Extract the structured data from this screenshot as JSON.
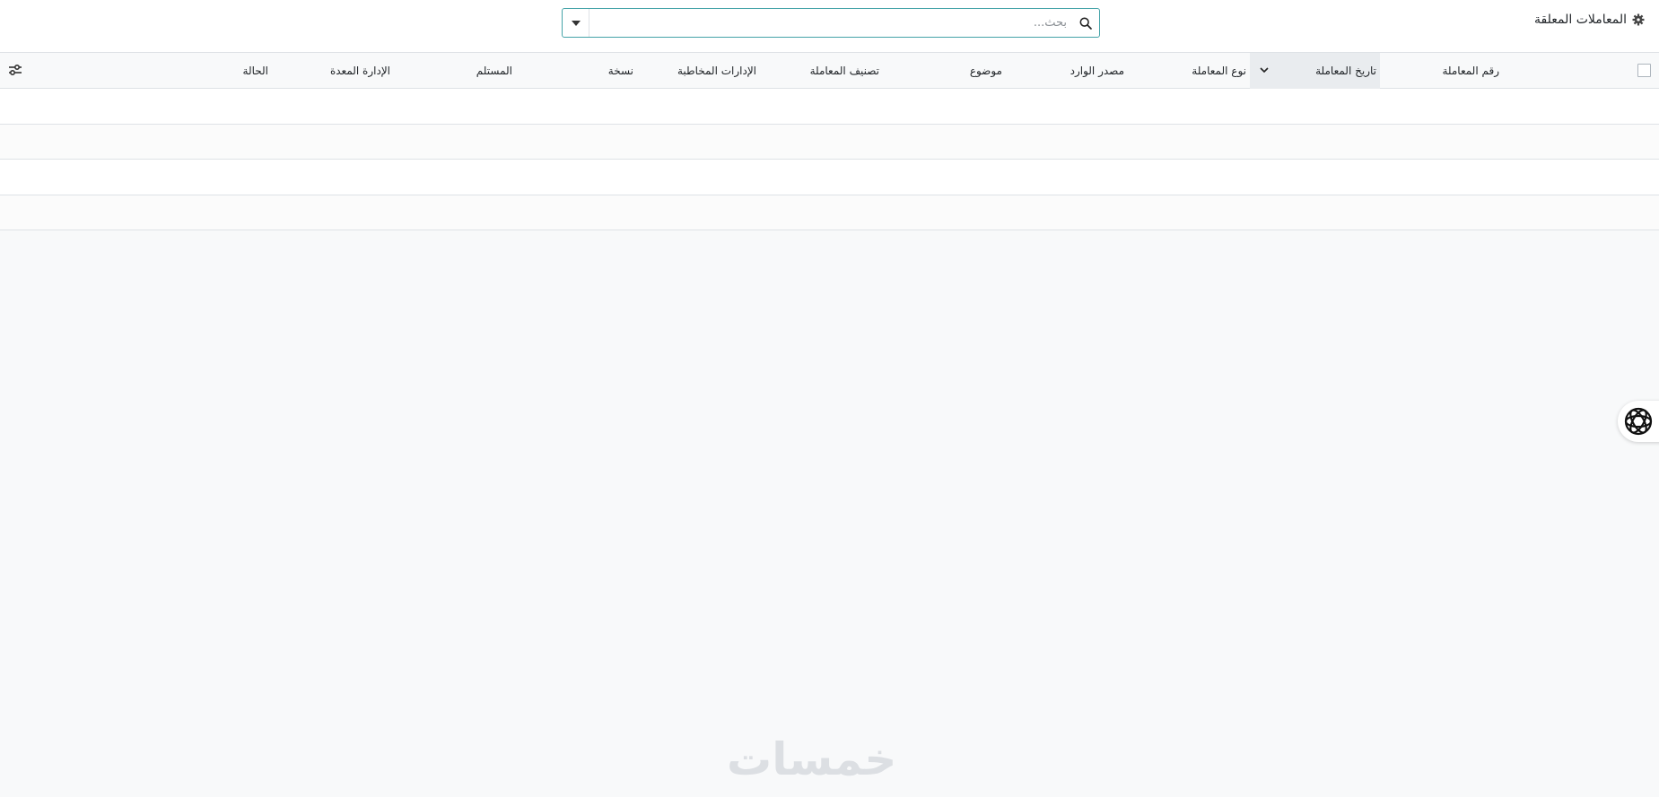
{
  "breadcrumb": {
    "title": "المعاملات المعلقة",
    "icon": "gear-icon"
  },
  "search": {
    "placeholder": "بحث...",
    "value": ""
  },
  "table": {
    "columns": [
      "رقم المعاملة",
      "تاريخ المعاملة",
      "نوع المعاملة",
      "مصدر الوارد",
      "موضوع",
      "تصنيف المعاملة",
      "الإدارات المخاطبة",
      "نسخة",
      "المستلم",
      "الإدارة المعدة",
      "الحالة"
    ],
    "sorted_column": "تاريخ المعاملة",
    "empty_rows": 4
  },
  "watermark": {
    "text": "خمسات"
  },
  "colors": {
    "accent": "#45a3a8",
    "border": "#dee2e6",
    "background": "#f8f9fa",
    "header_sorted_bg": "#e9ecef"
  }
}
